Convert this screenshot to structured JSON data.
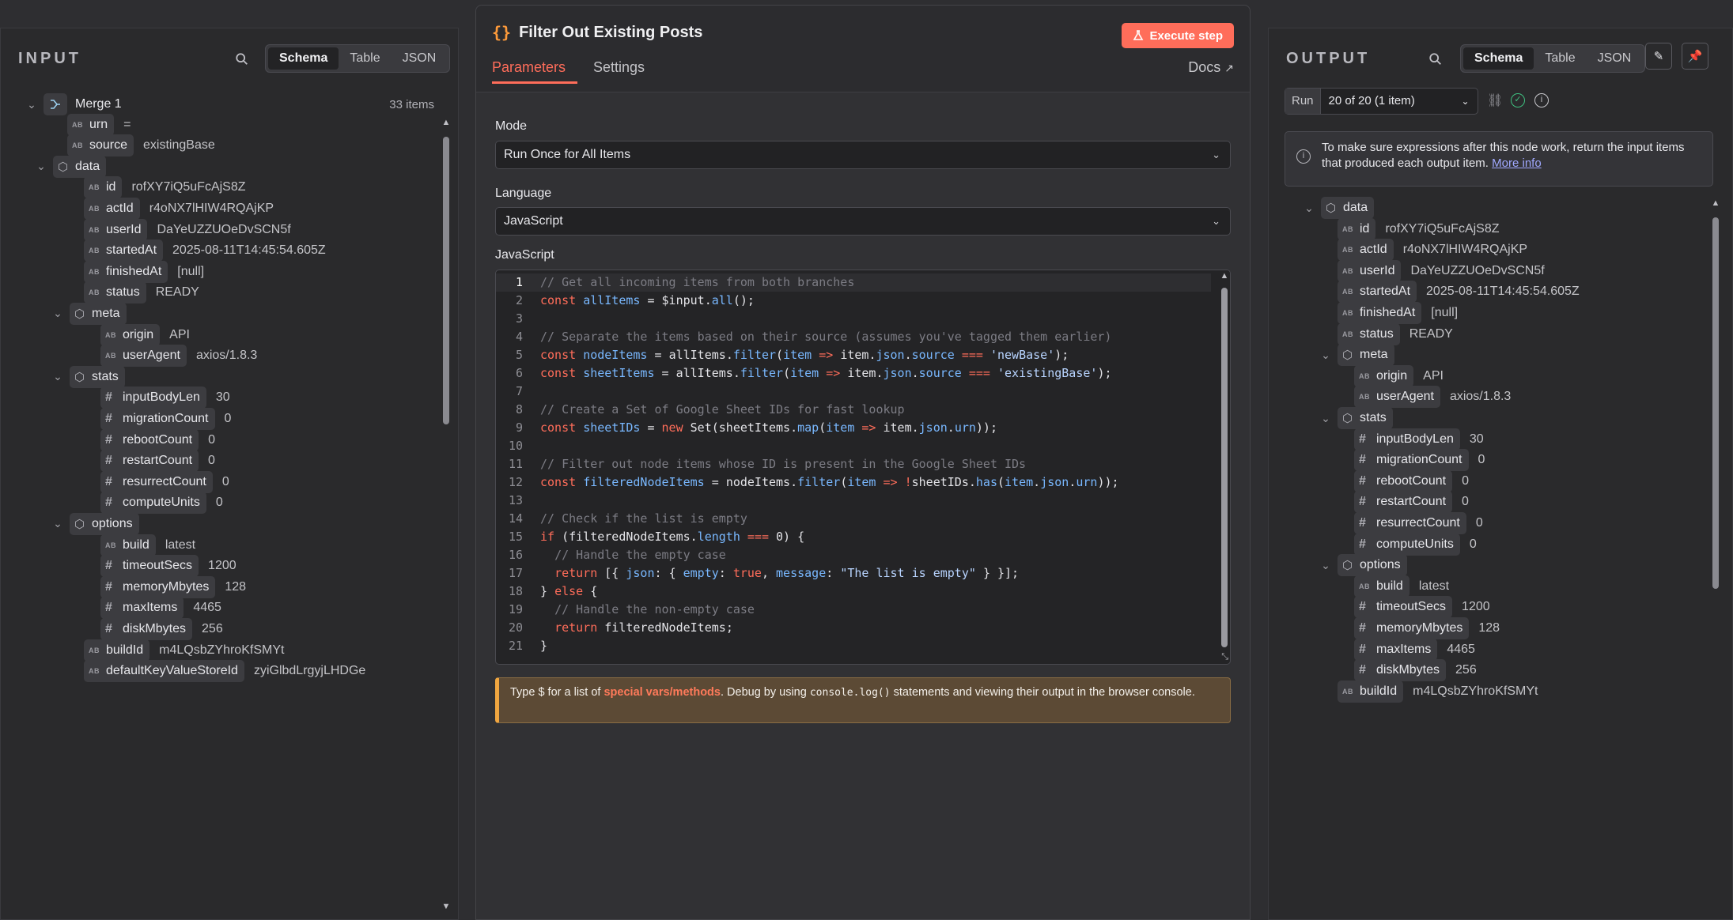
{
  "input": {
    "title": "INPUT",
    "views": [
      "Schema",
      "Table",
      "JSON"
    ],
    "active_view": "Schema",
    "root": {
      "name": "Merge 1",
      "count": "33 items"
    },
    "rows": [
      {
        "depth": 1,
        "kind": "str",
        "key": "urn",
        "value": "="
      },
      {
        "depth": 1,
        "kind": "str",
        "key": "source",
        "value": "existingBase"
      },
      {
        "depth": 1,
        "kind": "obj",
        "key": "data",
        "value": ""
      },
      {
        "depth": 2,
        "kind": "str",
        "key": "id",
        "value": "rofXY7iQ5uFcAjS8Z"
      },
      {
        "depth": 2,
        "kind": "str",
        "key": "actId",
        "value": "r4oNX7lHIW4RQAjKP"
      },
      {
        "depth": 2,
        "kind": "str",
        "key": "userId",
        "value": "DaYeUZZUOeDvSCN5f"
      },
      {
        "depth": 2,
        "kind": "str",
        "key": "startedAt",
        "value": "2025-08-11T14:45:54.605Z"
      },
      {
        "depth": 2,
        "kind": "str",
        "key": "finishedAt",
        "value": "[null]"
      },
      {
        "depth": 2,
        "kind": "str",
        "key": "status",
        "value": "READY"
      },
      {
        "depth": 2,
        "kind": "obj",
        "key": "meta",
        "value": ""
      },
      {
        "depth": 3,
        "kind": "str",
        "key": "origin",
        "value": "API"
      },
      {
        "depth": 3,
        "kind": "str",
        "key": "userAgent",
        "value": "axios/1.8.3"
      },
      {
        "depth": 2,
        "kind": "obj",
        "key": "stats",
        "value": ""
      },
      {
        "depth": 3,
        "kind": "num",
        "key": "inputBodyLen",
        "value": "30"
      },
      {
        "depth": 3,
        "kind": "num",
        "key": "migrationCount",
        "value": "0"
      },
      {
        "depth": 3,
        "kind": "num",
        "key": "rebootCount",
        "value": "0"
      },
      {
        "depth": 3,
        "kind": "num",
        "key": "restartCount",
        "value": "0"
      },
      {
        "depth": 3,
        "kind": "num",
        "key": "resurrectCount",
        "value": "0"
      },
      {
        "depth": 3,
        "kind": "num",
        "key": "computeUnits",
        "value": "0"
      },
      {
        "depth": 2,
        "kind": "obj",
        "key": "options",
        "value": ""
      },
      {
        "depth": 3,
        "kind": "str",
        "key": "build",
        "value": "latest"
      },
      {
        "depth": 3,
        "kind": "num",
        "key": "timeoutSecs",
        "value": "1200"
      },
      {
        "depth": 3,
        "kind": "num",
        "key": "memoryMbytes",
        "value": "128"
      },
      {
        "depth": 3,
        "kind": "num",
        "key": "maxItems",
        "value": "4465"
      },
      {
        "depth": 3,
        "kind": "num",
        "key": "diskMbytes",
        "value": "256"
      },
      {
        "depth": 2,
        "kind": "str",
        "key": "buildId",
        "value": "m4LQsbZYhroKfSMYt"
      },
      {
        "depth": 2,
        "kind": "str",
        "key": "defaultKeyValueStoreId",
        "value": "zyiGlbdLrgyjLHDGe"
      }
    ]
  },
  "node": {
    "title": "Filter Out Existing Posts",
    "execute_label": "Execute step",
    "tabs": [
      "Parameters",
      "Settings"
    ],
    "active_tab": "Parameters",
    "docs_label": "Docs",
    "mode_label": "Mode",
    "mode_value": "Run Once for All Items",
    "language_label": "Language",
    "language_value": "JavaScript",
    "code_label": "JavaScript",
    "tip_pre": "Type $ for a list of ",
    "tip_link": "special vars/methods",
    "tip_mid": ". Debug by using ",
    "tip_code": "console.log()",
    "tip_post": " statements and viewing their output in the browser console."
  },
  "code_lines": [
    "// Get all incoming items from both branches",
    "const allItems = $input.all();",
    "",
    "// Separate the items based on their source (assumes you've tagged them earlier)",
    "const nodeItems = allItems.filter(item => item.json.source === 'newBase');",
    "const sheetItems = allItems.filter(item => item.json.source === 'existingBase');",
    "",
    "// Create a Set of Google Sheet IDs for fast lookup",
    "const sheetIDs = new Set(sheetItems.map(item => item.json.urn));",
    "",
    "// Filter out node items whose ID is present in the Google Sheet IDs",
    "const filteredNodeItems = nodeItems.filter(item => !sheetIDs.has(item.json.urn));",
    "",
    "// Check if the list is empty",
    "if (filteredNodeItems.length === 0) {",
    "  // Handle the empty case",
    "  return [{ json: { empty: true, message: \"The list is empty\" } }];",
    "} else {",
    "  // Handle the non-empty case",
    "  return filteredNodeItems;",
    "}"
  ],
  "output": {
    "title": "OUTPUT",
    "views": [
      "Schema",
      "Table",
      "JSON"
    ],
    "active_view": "Schema",
    "run_label": "Run",
    "run_value": "20 of 20 (1 item)",
    "notice_text": "To make sure expressions after this node work, return the input items that produced each output item.",
    "notice_link": "More info",
    "rows": [
      {
        "depth": 1,
        "kind": "obj",
        "key": "data",
        "value": ""
      },
      {
        "depth": 2,
        "kind": "str",
        "key": "id",
        "value": "rofXY7iQ5uFcAjS8Z"
      },
      {
        "depth": 2,
        "kind": "str",
        "key": "actId",
        "value": "r4oNX7lHIW4RQAjKP"
      },
      {
        "depth": 2,
        "kind": "str",
        "key": "userId",
        "value": "DaYeUZZUOeDvSCN5f"
      },
      {
        "depth": 2,
        "kind": "str",
        "key": "startedAt",
        "value": "2025-08-11T14:45:54.605Z"
      },
      {
        "depth": 2,
        "kind": "str",
        "key": "finishedAt",
        "value": "[null]"
      },
      {
        "depth": 2,
        "kind": "str",
        "key": "status",
        "value": "READY"
      },
      {
        "depth": 2,
        "kind": "obj",
        "key": "meta",
        "value": ""
      },
      {
        "depth": 3,
        "kind": "str",
        "key": "origin",
        "value": "API"
      },
      {
        "depth": 3,
        "kind": "str",
        "key": "userAgent",
        "value": "axios/1.8.3"
      },
      {
        "depth": 2,
        "kind": "obj",
        "key": "stats",
        "value": ""
      },
      {
        "depth": 3,
        "kind": "num",
        "key": "inputBodyLen",
        "value": "30"
      },
      {
        "depth": 3,
        "kind": "num",
        "key": "migrationCount",
        "value": "0"
      },
      {
        "depth": 3,
        "kind": "num",
        "key": "rebootCount",
        "value": "0"
      },
      {
        "depth": 3,
        "kind": "num",
        "key": "restartCount",
        "value": "0"
      },
      {
        "depth": 3,
        "kind": "num",
        "key": "resurrectCount",
        "value": "0"
      },
      {
        "depth": 3,
        "kind": "num",
        "key": "computeUnits",
        "value": "0"
      },
      {
        "depth": 2,
        "kind": "obj",
        "key": "options",
        "value": ""
      },
      {
        "depth": 3,
        "kind": "str",
        "key": "build",
        "value": "latest"
      },
      {
        "depth": 3,
        "kind": "num",
        "key": "timeoutSecs",
        "value": "1200"
      },
      {
        "depth": 3,
        "kind": "num",
        "key": "memoryMbytes",
        "value": "128"
      },
      {
        "depth": 3,
        "kind": "num",
        "key": "maxItems",
        "value": "4465"
      },
      {
        "depth": 3,
        "kind": "num",
        "key": "diskMbytes",
        "value": "256"
      },
      {
        "depth": 2,
        "kind": "str",
        "key": "buildId",
        "value": "m4LQsbZYhroKfSMYt"
      }
    ]
  },
  "colors": {
    "accent": "#ff6d5a",
    "code_keyword": "#ff6d5a",
    "code_ident": "#79b8ff"
  }
}
